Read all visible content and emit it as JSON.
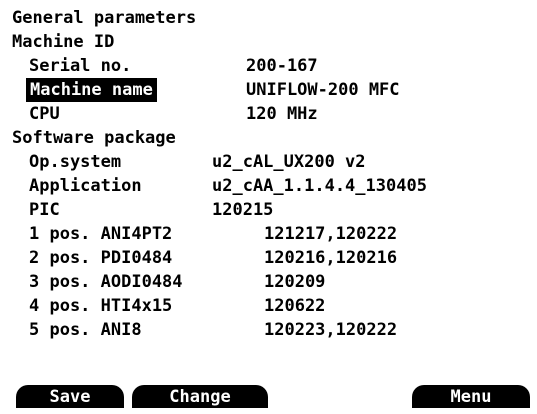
{
  "title": "General parameters",
  "machine_id": {
    "heading": "Machine ID",
    "serial": {
      "label": "Serial no.",
      "value": "200-167"
    },
    "name": {
      "label": "Machine name",
      "value": "UNIFLOW-200 MFC"
    },
    "cpu": {
      "label": "CPU",
      "value": "120 MHz"
    }
  },
  "software": {
    "heading": "Software package",
    "opsystem": {
      "label": "Op.system",
      "value": "u2_cAL_UX200 v2"
    },
    "application": {
      "label": "Application",
      "value": "u2_cAA_1.1.4.4_130405"
    },
    "pic": {
      "label": "PIC",
      "value": "120215"
    },
    "modules": [
      {
        "label": "1 pos. ANI4PT2",
        "value": "121217,120222"
      },
      {
        "label": "2 pos. PDI0484",
        "value": "120216,120216"
      },
      {
        "label": "3 pos. AODI0484",
        "value": "120209"
      },
      {
        "label": "4 pos. HTI4x15",
        "value": "120622"
      },
      {
        "label": "5 pos. ANI8",
        "value": "120223,120222"
      }
    ]
  },
  "softkeys": {
    "save": "Save",
    "change": "Change",
    "menu": "Menu"
  },
  "colors": {
    "background": "#ffffff",
    "foreground": "#000000",
    "highlight_bg": "#000000",
    "highlight_fg": "#ffffff"
  }
}
